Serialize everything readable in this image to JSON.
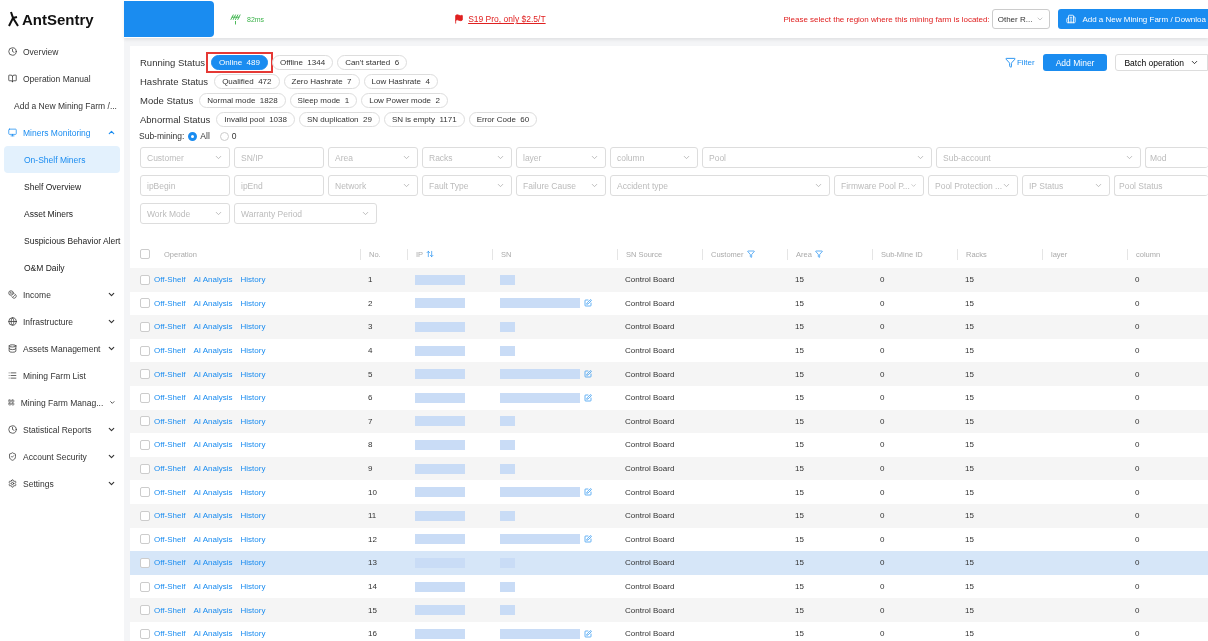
{
  "logo": "AntSentry",
  "header": {
    "latency": "82ms",
    "promo": "S19 Pro, only $2.5/T",
    "region_prompt": "Please select the region where this mining farm is located:",
    "region_value": "Other R...",
    "add_farm_button": "Add a New Mining Farm / Downloa"
  },
  "sidebar": {
    "items": [
      {
        "label": "Overview",
        "selected": false
      },
      {
        "label": "Operation Manual",
        "selected": false
      },
      {
        "label": "Add a New Mining Farm /...",
        "selected": false
      },
      {
        "label": "Miners Monitoring",
        "selected": true,
        "expanded": true,
        "children": [
          {
            "label": "On-Shelf Miners",
            "selected": true
          },
          {
            "label": "Shelf Overview",
            "selected": false
          },
          {
            "label": "Asset Miners",
            "selected": false
          },
          {
            "label": "Suspicious Behavior Alert",
            "selected": false
          },
          {
            "label": "O&M Daily",
            "selected": false
          }
        ]
      },
      {
        "label": "Income",
        "selected": false,
        "expanded": false
      },
      {
        "label": "Infrastructure",
        "selected": false,
        "expanded": false
      },
      {
        "label": "Assets Management",
        "selected": false,
        "expanded": false
      },
      {
        "label": "Mining Farm List",
        "selected": false
      },
      {
        "label": "Mining Farm Manag...",
        "selected": false,
        "expanded": false
      },
      {
        "label": "Statistical Reports",
        "selected": false,
        "expanded": false
      },
      {
        "label": "Account Security",
        "selected": false,
        "expanded": false
      },
      {
        "label": "Settings",
        "selected": false,
        "expanded": false
      }
    ]
  },
  "status_groups": [
    {
      "label": "Running Status",
      "tags": [
        {
          "label": "Online",
          "count": "489",
          "selected": true,
          "highlighted": true
        },
        {
          "label": "Offline",
          "count": "1344",
          "selected": false,
          "highlighted": false
        },
        {
          "label": "Can't started",
          "count": "6",
          "selected": false,
          "highlighted": false
        }
      ]
    },
    {
      "label": "Hashrate Status",
      "tags": [
        {
          "label": "Qualified",
          "count": "472",
          "selected": false,
          "highlighted": false
        },
        {
          "label": "Zero Hashrate",
          "count": "7",
          "selected": false,
          "highlighted": false
        },
        {
          "label": "Low Hashrate",
          "count": "4",
          "selected": false,
          "highlighted": false
        }
      ]
    },
    {
      "label": "Mode Status",
      "tags": [
        {
          "label": "Normal mode",
          "count": "1828",
          "selected": false,
          "highlighted": false
        },
        {
          "label": "Sleep mode",
          "count": "1",
          "selected": false,
          "highlighted": false
        },
        {
          "label": "Low Power mode",
          "count": "2",
          "selected": false,
          "highlighted": false
        }
      ]
    },
    {
      "label": "Abnormal Status",
      "tags": [
        {
          "label": "Invalid pool",
          "count": "1038",
          "selected": false,
          "highlighted": false
        },
        {
          "label": "SN duplication",
          "count": "29",
          "selected": false,
          "highlighted": false
        },
        {
          "label": "SN is empty",
          "count": "1171",
          "selected": false,
          "highlighted": false
        },
        {
          "label": "Error Code",
          "count": "60",
          "selected": false,
          "highlighted": false
        }
      ]
    }
  ],
  "actions": {
    "filter": "Filter",
    "add_miner": "Add Miner",
    "batch": "Batch operation"
  },
  "sub_mining": {
    "label": "Sub-mining:",
    "options": [
      {
        "label": "All",
        "selected": true
      },
      {
        "label": "0",
        "selected": false
      }
    ]
  },
  "filters": [
    [
      {
        "placeholder": "Customer",
        "kind": "select"
      },
      {
        "placeholder": "SN/IP",
        "kind": "input"
      },
      {
        "placeholder": "Area",
        "kind": "select"
      },
      {
        "placeholder": "Racks",
        "kind": "select"
      },
      {
        "placeholder": "layer",
        "kind": "select"
      },
      {
        "placeholder": "column",
        "kind": "select"
      },
      {
        "placeholder": "Pool",
        "kind": "select"
      },
      {
        "placeholder": "Sub-account",
        "kind": "select"
      },
      {
        "placeholder": "Mod",
        "kind": "cut"
      }
    ],
    [
      {
        "placeholder": "ipBegin",
        "kind": "input"
      },
      {
        "placeholder": "ipEnd",
        "kind": "input"
      },
      {
        "placeholder": "Network",
        "kind": "select"
      },
      {
        "placeholder": "Fault Type",
        "kind": "select"
      },
      {
        "placeholder": "Failure Cause",
        "kind": "select"
      },
      {
        "placeholder": "Accident type",
        "kind": "select"
      },
      {
        "placeholder": "Firmware Pool P...",
        "kind": "select"
      },
      {
        "placeholder": "Pool Protection ...",
        "kind": "select"
      },
      {
        "placeholder": "IP Status",
        "kind": "select"
      },
      {
        "placeholder": "Pool Status",
        "kind": "cut"
      }
    ],
    [
      {
        "placeholder": "Work Mode",
        "kind": "select"
      },
      {
        "placeholder": "Warranty Period",
        "kind": "select"
      }
    ]
  ],
  "table": {
    "all_checked": false,
    "columns": [
      {
        "label": "Operation",
        "kind": "plain"
      },
      {
        "label": "No.",
        "kind": "plain"
      },
      {
        "label": "IP",
        "kind": "sort"
      },
      {
        "label": "SN",
        "kind": "plain"
      },
      {
        "label": "SN Source",
        "kind": "plain"
      },
      {
        "label": "Customer",
        "kind": "filter"
      },
      {
        "label": "Area",
        "kind": "filter"
      },
      {
        "label": "Sub-Mine ID",
        "kind": "plain"
      },
      {
        "label": "Racks",
        "kind": "plain"
      },
      {
        "label": "layer",
        "kind": "plain"
      },
      {
        "label": "column",
        "kind": "plain"
      }
    ],
    "rows": [
      {
        "checked": false,
        "actions": [
          "Off-Shelf",
          "AI Analysis",
          "History"
        ],
        "no": "1",
        "sn_editable": false,
        "sn_source": "Control Board",
        "area": "15",
        "sub_mine_id": "0",
        "racks": "15",
        "column": "0",
        "selected": false
      },
      {
        "checked": false,
        "actions": [
          "Off-Shelf",
          "AI Analysis",
          "History"
        ],
        "no": "2",
        "sn_editable": true,
        "sn_source": "Control Board",
        "area": "15",
        "sub_mine_id": "0",
        "racks": "15",
        "column": "0",
        "selected": false
      },
      {
        "checked": false,
        "actions": [
          "Off-Shelf",
          "AI Analysis",
          "History"
        ],
        "no": "3",
        "sn_editable": false,
        "sn_source": "Control Board",
        "area": "15",
        "sub_mine_id": "0",
        "racks": "15",
        "column": "0",
        "selected": false
      },
      {
        "checked": false,
        "actions": [
          "Off-Shelf",
          "AI Analysis",
          "History"
        ],
        "no": "4",
        "sn_editable": false,
        "sn_source": "Control Board",
        "area": "15",
        "sub_mine_id": "0",
        "racks": "15",
        "column": "0",
        "selected": false
      },
      {
        "checked": false,
        "actions": [
          "Off-Shelf",
          "AI Analysis",
          "History"
        ],
        "no": "5",
        "sn_editable": true,
        "sn_source": "Control Board",
        "area": "15",
        "sub_mine_id": "0",
        "racks": "15",
        "column": "0",
        "selected": false
      },
      {
        "checked": false,
        "actions": [
          "Off-Shelf",
          "AI Analysis",
          "History"
        ],
        "no": "6",
        "sn_editable": true,
        "sn_source": "Control Board",
        "area": "15",
        "sub_mine_id": "0",
        "racks": "15",
        "column": "0",
        "selected": false
      },
      {
        "checked": false,
        "actions": [
          "Off-Shelf",
          "AI Analysis",
          "History"
        ],
        "no": "7",
        "sn_editable": false,
        "sn_source": "Control Board",
        "area": "15",
        "sub_mine_id": "0",
        "racks": "15",
        "column": "0",
        "selected": false
      },
      {
        "checked": false,
        "actions": [
          "Off-Shelf",
          "AI Analysis",
          "History"
        ],
        "no": "8",
        "sn_editable": false,
        "sn_source": "Control Board",
        "area": "15",
        "sub_mine_id": "0",
        "racks": "15",
        "column": "0",
        "selected": false
      },
      {
        "checked": false,
        "actions": [
          "Off-Shelf",
          "AI Analysis",
          "History"
        ],
        "no": "9",
        "sn_editable": false,
        "sn_source": "Control Board",
        "area": "15",
        "sub_mine_id": "0",
        "racks": "15",
        "column": "0",
        "selected": false
      },
      {
        "checked": false,
        "actions": [
          "Off-Shelf",
          "AI Analysis",
          "History"
        ],
        "no": "10",
        "sn_editable": true,
        "sn_source": "Control Board",
        "area": "15",
        "sub_mine_id": "0",
        "racks": "15",
        "column": "0",
        "selected": false
      },
      {
        "checked": false,
        "actions": [
          "Off-Shelf",
          "AI Analysis",
          "History"
        ],
        "no": "11",
        "sn_editable": false,
        "sn_source": "Control Board",
        "area": "15",
        "sub_mine_id": "0",
        "racks": "15",
        "column": "0",
        "selected": false
      },
      {
        "checked": false,
        "actions": [
          "Off-Shelf",
          "AI Analysis",
          "History"
        ],
        "no": "12",
        "sn_editable": true,
        "sn_source": "Control Board",
        "area": "15",
        "sub_mine_id": "0",
        "racks": "15",
        "column": "0",
        "selected": false
      },
      {
        "checked": false,
        "actions": [
          "Off-Shelf",
          "AI Analysis",
          "History"
        ],
        "no": "13",
        "sn_editable": false,
        "sn_source": "Control Board",
        "area": "15",
        "sub_mine_id": "0",
        "racks": "15",
        "column": "0",
        "selected": true
      },
      {
        "checked": false,
        "actions": [
          "Off-Shelf",
          "AI Analysis",
          "History"
        ],
        "no": "14",
        "sn_editable": false,
        "sn_source": "Control Board",
        "area": "15",
        "sub_mine_id": "0",
        "racks": "15",
        "column": "0",
        "selected": false
      },
      {
        "checked": false,
        "actions": [
          "Off-Shelf",
          "AI Analysis",
          "History"
        ],
        "no": "15",
        "sn_editable": false,
        "sn_source": "Control Board",
        "area": "15",
        "sub_mine_id": "0",
        "racks": "15",
        "column": "0",
        "selected": false
      },
      {
        "checked": false,
        "actions": [
          "Off-Shelf",
          "AI Analysis",
          "History"
        ],
        "no": "16",
        "sn_editable": true,
        "sn_source": "Control Board",
        "area": "15",
        "sub_mine_id": "0",
        "racks": "15",
        "column": "0",
        "selected": false
      }
    ]
  }
}
